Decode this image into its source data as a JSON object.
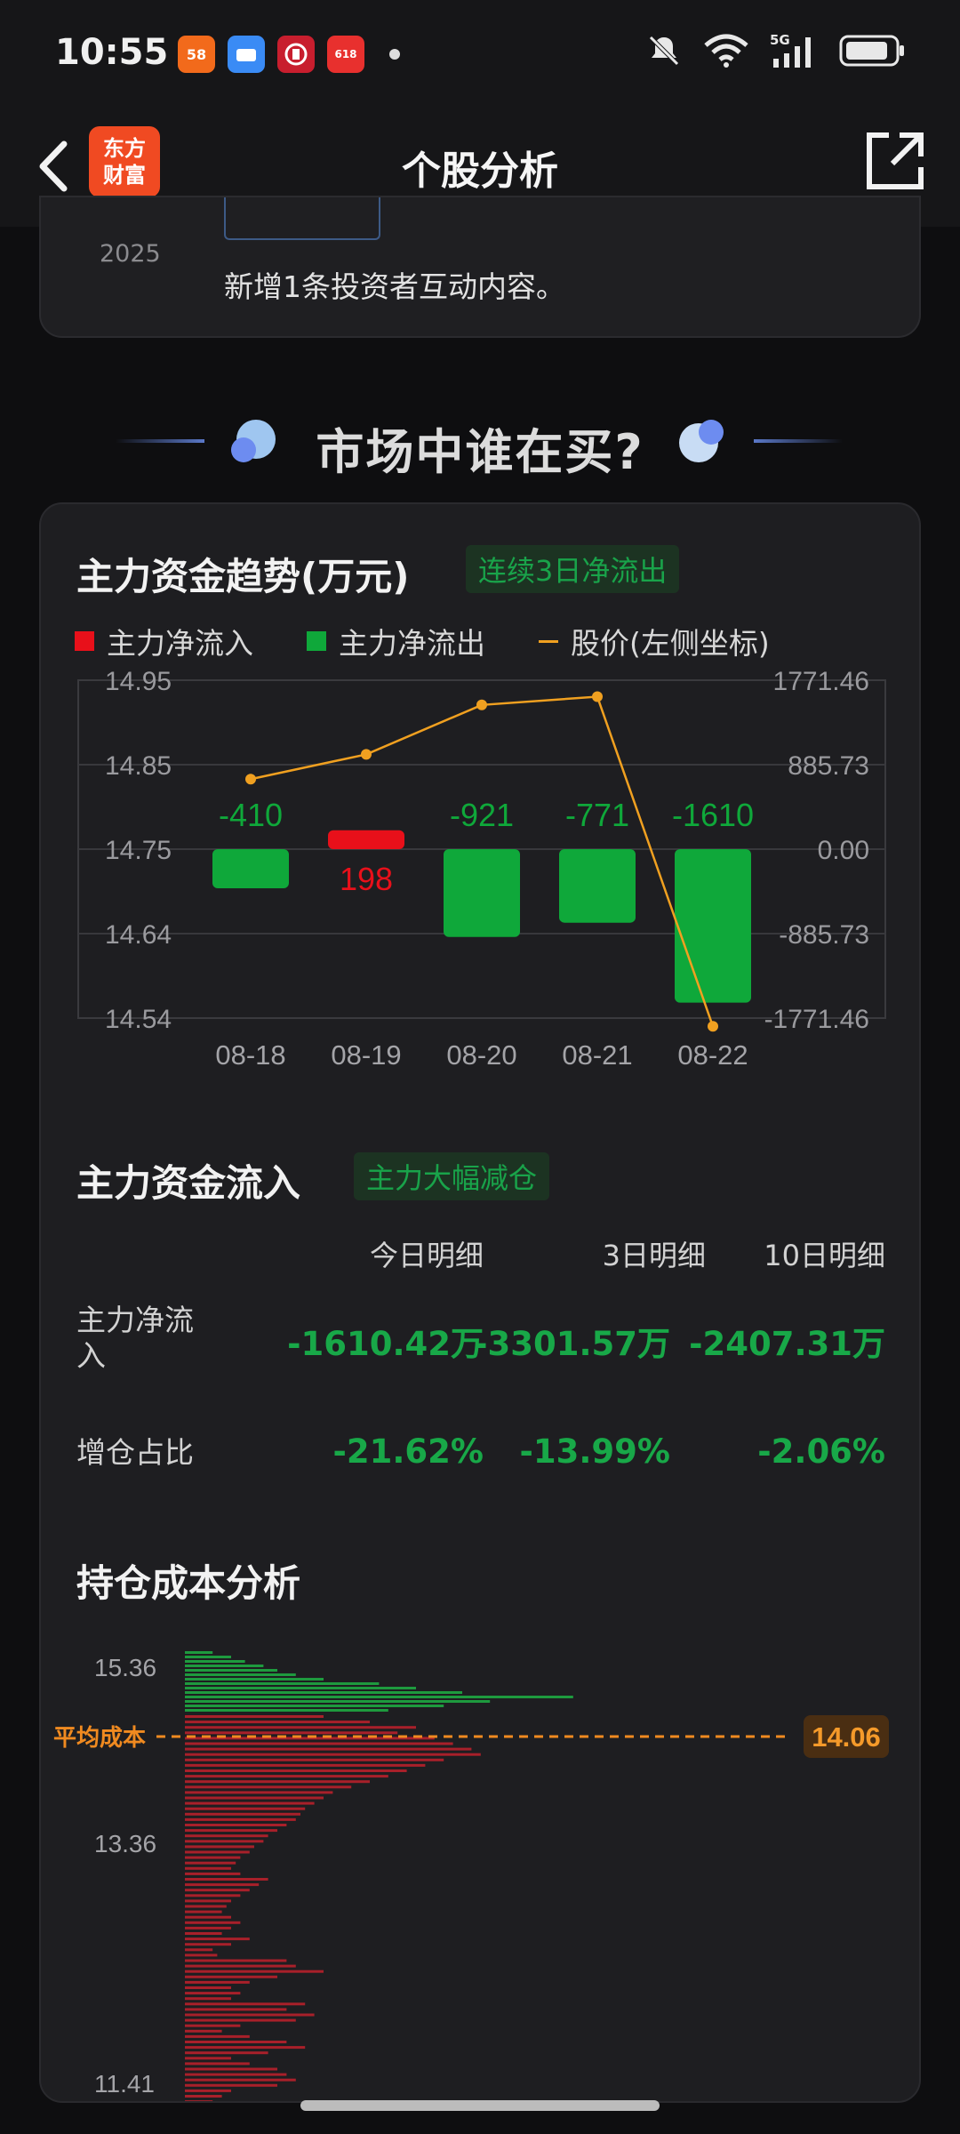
{
  "status": {
    "time": "10:55",
    "apps": [
      {
        "label": "58",
        "color": "#f26a1b"
      },
      {
        "label": "",
        "color": "#3a8bf5"
      },
      {
        "label": "中",
        "color": "#c81e2e"
      },
      {
        "label": "618",
        "color": "#e8302e"
      }
    ],
    "network": "5G"
  },
  "nav": {
    "brand_line1": "东方",
    "brand_line2": "财富",
    "title": "个股分析"
  },
  "news": {
    "year": "2025",
    "text": "新增1条投资者互动内容。"
  },
  "banner": {
    "title": "市场中谁在买?"
  },
  "trend": {
    "title": "主力资金趋势(万元)",
    "tag": "连续3日净流出",
    "legend": {
      "inflow": "主力净流入",
      "outflow": "主力净流出",
      "price": "股价(左侧坐标)"
    },
    "colors": {
      "inflow": "#e8101a",
      "outflow": "#0fa83a",
      "price": "#f0a020"
    }
  },
  "chart_data": {
    "type": "bar",
    "title": "主力资金趋势(万元)",
    "categories": [
      "08-18",
      "08-19",
      "08-20",
      "08-21",
      "08-22"
    ],
    "series": [
      {
        "name": "主力净流入",
        "values": [
          0,
          198,
          0,
          0,
          0
        ]
      },
      {
        "name": "主力净流出",
        "values": [
          -410,
          0,
          -921,
          -771,
          -1610
        ]
      },
      {
        "name": "股价(左侧坐标)",
        "type": "line",
        "values": [
          14.83,
          14.86,
          14.92,
          14.93,
          14.53
        ]
      }
    ],
    "bar_labels": [
      "-410",
      "198",
      "-921",
      "-771",
      "-1610"
    ],
    "left_ticks": [
      "14.95",
      "14.85",
      "14.75",
      "14.64",
      "14.54"
    ],
    "right_ticks": [
      "1771.46",
      "885.73",
      "0.00",
      "-885.73",
      "-1771.46"
    ],
    "ylim_left": [
      14.54,
      14.95
    ],
    "ylim_right": [
      -1771.46,
      1771.46
    ],
    "grid": true,
    "legend_position": "top-left"
  },
  "flow": {
    "title": "主力资金流入",
    "tag": "主力大幅减仓",
    "headers": [
      "今日明细",
      "3日明细",
      "10日明细"
    ],
    "rows": [
      {
        "label": "主力净流入",
        "values": [
          "-1610.42万",
          "-3301.57万",
          "-2407.31万"
        ]
      },
      {
        "label": "增仓占比",
        "values": [
          "-21.62%",
          "-13.99%",
          "-2.06%"
        ]
      }
    ]
  },
  "cost": {
    "title": "持仓成本分析",
    "avg_label": "平均成本",
    "avg_value": "14.06",
    "ticks": [
      "15.36",
      "13.36",
      "11.41"
    ],
    "distribution_above": [
      0.06,
      0.1,
      0.13,
      0.17,
      0.2,
      0.24,
      0.3,
      0.42,
      0.5,
      0.6,
      0.84,
      0.66,
      0.56,
      0.44
    ],
    "distribution_below": [
      0.3,
      0.4,
      0.5,
      0.46,
      0.54,
      0.58,
      0.62,
      0.64,
      0.56,
      0.52,
      0.48,
      0.44,
      0.4,
      0.36,
      0.32,
      0.3,
      0.28,
      0.26,
      0.25,
      0.24,
      0.22,
      0.2,
      0.18,
      0.17,
      0.15,
      0.14,
      0.12,
      0.11,
      0.1,
      0.12,
      0.18,
      0.16,
      0.14,
      0.12,
      0.1,
      0.09,
      0.08,
      0.1,
      0.12,
      0.1,
      0.08,
      0.14,
      0.1,
      0.06,
      0.07,
      0.22,
      0.24,
      0.3,
      0.2,
      0.14,
      0.1,
      0.12,
      0.1,
      0.26,
      0.22,
      0.28,
      0.24,
      0.12,
      0.08,
      0.14,
      0.22,
      0.26,
      0.18,
      0.1,
      0.14,
      0.2,
      0.22,
      0.24,
      0.2,
      0.1,
      0.08,
      0.06,
      0.05
    ]
  }
}
